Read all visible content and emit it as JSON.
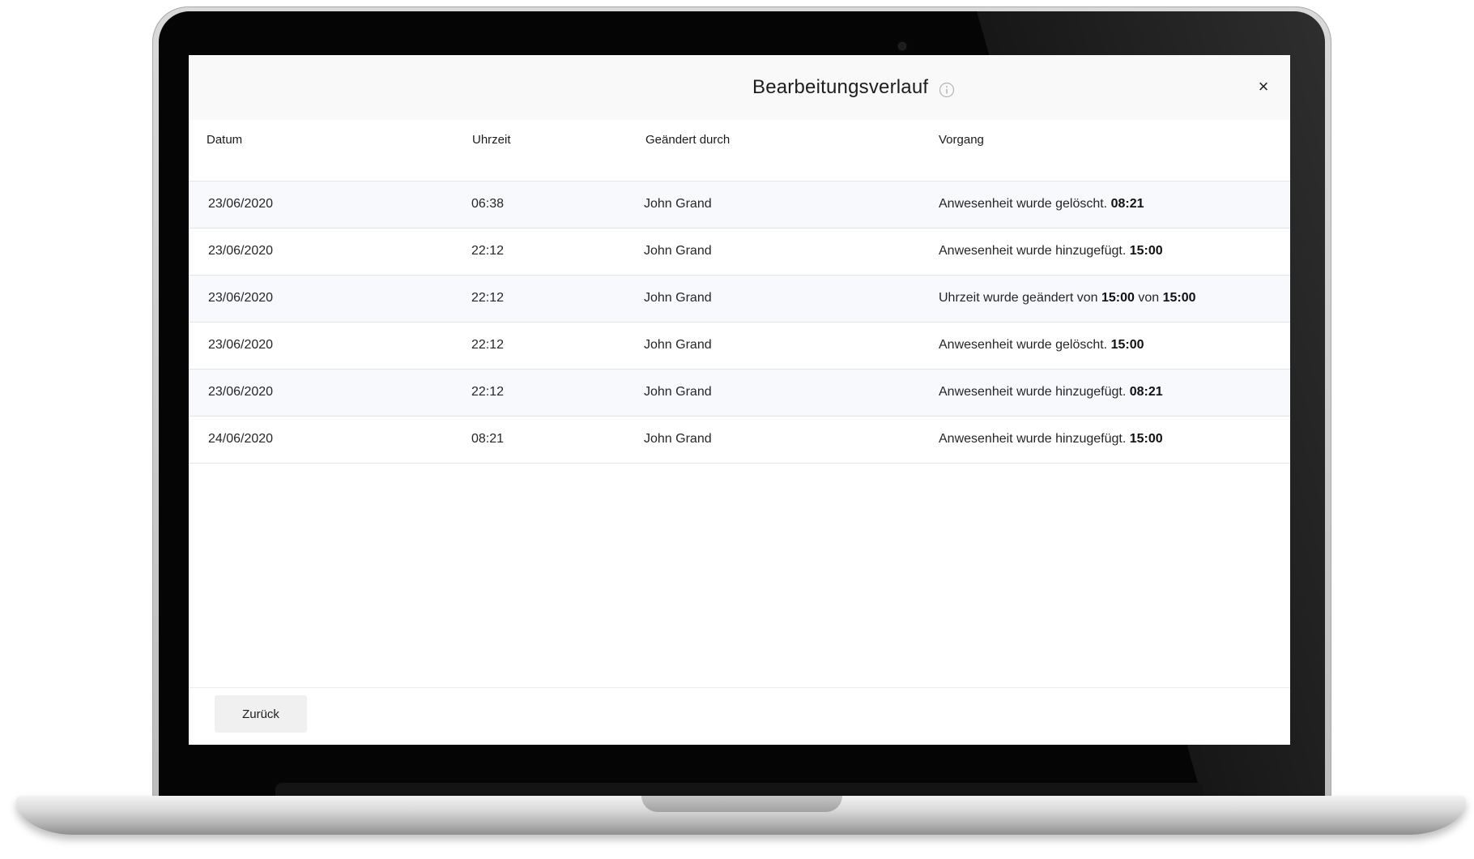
{
  "dialog": {
    "title": "Bearbeitungsverlauf",
    "close_icon": "×",
    "info_icon": "info-icon"
  },
  "table": {
    "columns": [
      "Datum",
      "Uhrzeit",
      "Geändert durch",
      "Vorgang"
    ],
    "rows": [
      {
        "date": "23/06/2020",
        "time": "06:38",
        "by": "John Grand",
        "action_text": "Anwesenheit wurde gelöscht. ",
        "action_value": "08:21"
      },
      {
        "date": "23/06/2020",
        "time": "22:12",
        "by": "John Grand",
        "action_text": "Anwesenheit wurde hinzugefügt. ",
        "action_value": "15:00"
      },
      {
        "date": "23/06/2020",
        "time": "22:12",
        "by": "John Grand",
        "action_text": "Uhrzeit wurde geändert von ",
        "action_value": "15:00",
        "action_text_2": " von ",
        "action_value_2": "15:00"
      },
      {
        "date": "23/06/2020",
        "time": "22:12",
        "by": "John Grand",
        "action_text": "Anwesenheit wurde gelöscht. ",
        "action_value": "15:00"
      },
      {
        "date": "23/06/2020",
        "time": "22:12",
        "by": "John Grand",
        "action_text": "Anwesenheit wurde hinzugefügt. ",
        "action_value": "08:21"
      },
      {
        "date": "24/06/2020",
        "time": "08:21",
        "by": "John Grand",
        "action_text": "Anwesenheit wurde hinzugefügt. ",
        "action_value": "15:00"
      }
    ]
  },
  "footer": {
    "back_label": "Zurück"
  }
}
